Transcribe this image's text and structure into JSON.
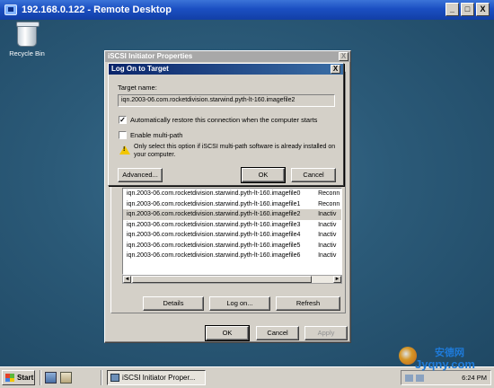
{
  "window": {
    "title": "192.168.0.122 - Remote Desktop",
    "min": "_",
    "max": "□",
    "close": "X"
  },
  "desktop": {
    "recycle_label": "Recycle Bin"
  },
  "iscsi": {
    "title": "iSCSI Initiator Properties",
    "close": "X",
    "targets": [
      {
        "name": "iqn.2003-06.com.rocketdivision.starwind.pyth-lt-160.imagefile0",
        "status": "Reconn"
      },
      {
        "name": "iqn.2003-06.com.rocketdivision.starwind.pyth-lt-160.imagefile1",
        "status": "Reconn"
      },
      {
        "name": "iqn.2003-06.com.rocketdivision.starwind.pyth-lt-160.imagefile2",
        "status": "Inactiv"
      },
      {
        "name": "iqn.2003-06.com.rocketdivision.starwind.pyth-lt-160.imagefile3",
        "status": "Inactiv"
      },
      {
        "name": "iqn.2003-06.com.rocketdivision.starwind.pyth-lt-160.imagefile4",
        "status": "Inactiv"
      },
      {
        "name": "iqn.2003-06.com.rocketdivision.starwind.pyth-lt-160.imagefile5",
        "status": "Inactiv"
      },
      {
        "name": "iqn.2003-06.com.rocketdivision.starwind.pyth-lt-160.imagefile6",
        "status": "Inactiv"
      }
    ],
    "selected_index": 2,
    "details": "Details",
    "logon": "Log on...",
    "refresh": "Refresh",
    "ok": "OK",
    "cancel": "Cancel",
    "apply": "Apply"
  },
  "logon": {
    "title": "Log On to Target",
    "close": "X",
    "target_label": "Target name:",
    "target_value": "iqn.2003-06.com.rocketdivision.starwind.pyth-lt-160.imagefile2",
    "auto_restore": {
      "label": "Automatically restore this connection when the computer starts",
      "checked": true,
      "mark": "✓"
    },
    "multipath": {
      "label": "Enable multi-path",
      "checked": false
    },
    "warning": "Only select this option if iSCSI multi-path software is already installed on your computer.",
    "warning_glyph": "!",
    "advanced": "Advanced...",
    "ok": "OK",
    "cancel": "Cancel"
  },
  "taskbar": {
    "start": "Start",
    "task_item": "iSCSI Initiator Proper...",
    "clock": "6:24 PM"
  },
  "watermark": {
    "line1": "安德网",
    "line2": "Jyqny.com"
  }
}
